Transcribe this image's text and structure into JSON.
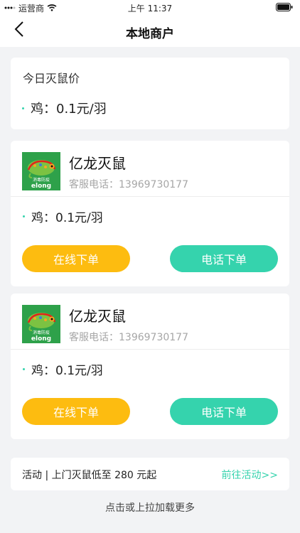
{
  "status_bar": {
    "carrier": "运营商",
    "time": "上午 11:37"
  },
  "nav": {
    "title": "本地商户"
  },
  "today_price": {
    "heading": "今日灭鼠价",
    "item": "鸡：0.1元/羽"
  },
  "merchants": [
    {
      "name": "亿龙灭鼠",
      "phone": "客服电话：13969730177",
      "price": "鸡：0.1元/羽",
      "online_order": "在线下单",
      "phone_order": "电话下单",
      "logo_text": "elong",
      "logo_cn": "消毒防疫"
    },
    {
      "name": "亿龙灭鼠",
      "phone": "客服电话：13969730177",
      "price": "鸡：0.1元/羽",
      "online_order": "在线下单",
      "phone_order": "电话下单",
      "logo_text": "elong",
      "logo_cn": "消毒防疫"
    }
  ],
  "activity": {
    "text": "活动 | 上门灭鼠低至 280 元起",
    "link": "前往活动>>"
  },
  "load_more": "点击或上拉加载更多",
  "colors": {
    "accent_green": "#35d3ad",
    "accent_yellow": "#fdbc10",
    "background": "#f2f3f5"
  }
}
